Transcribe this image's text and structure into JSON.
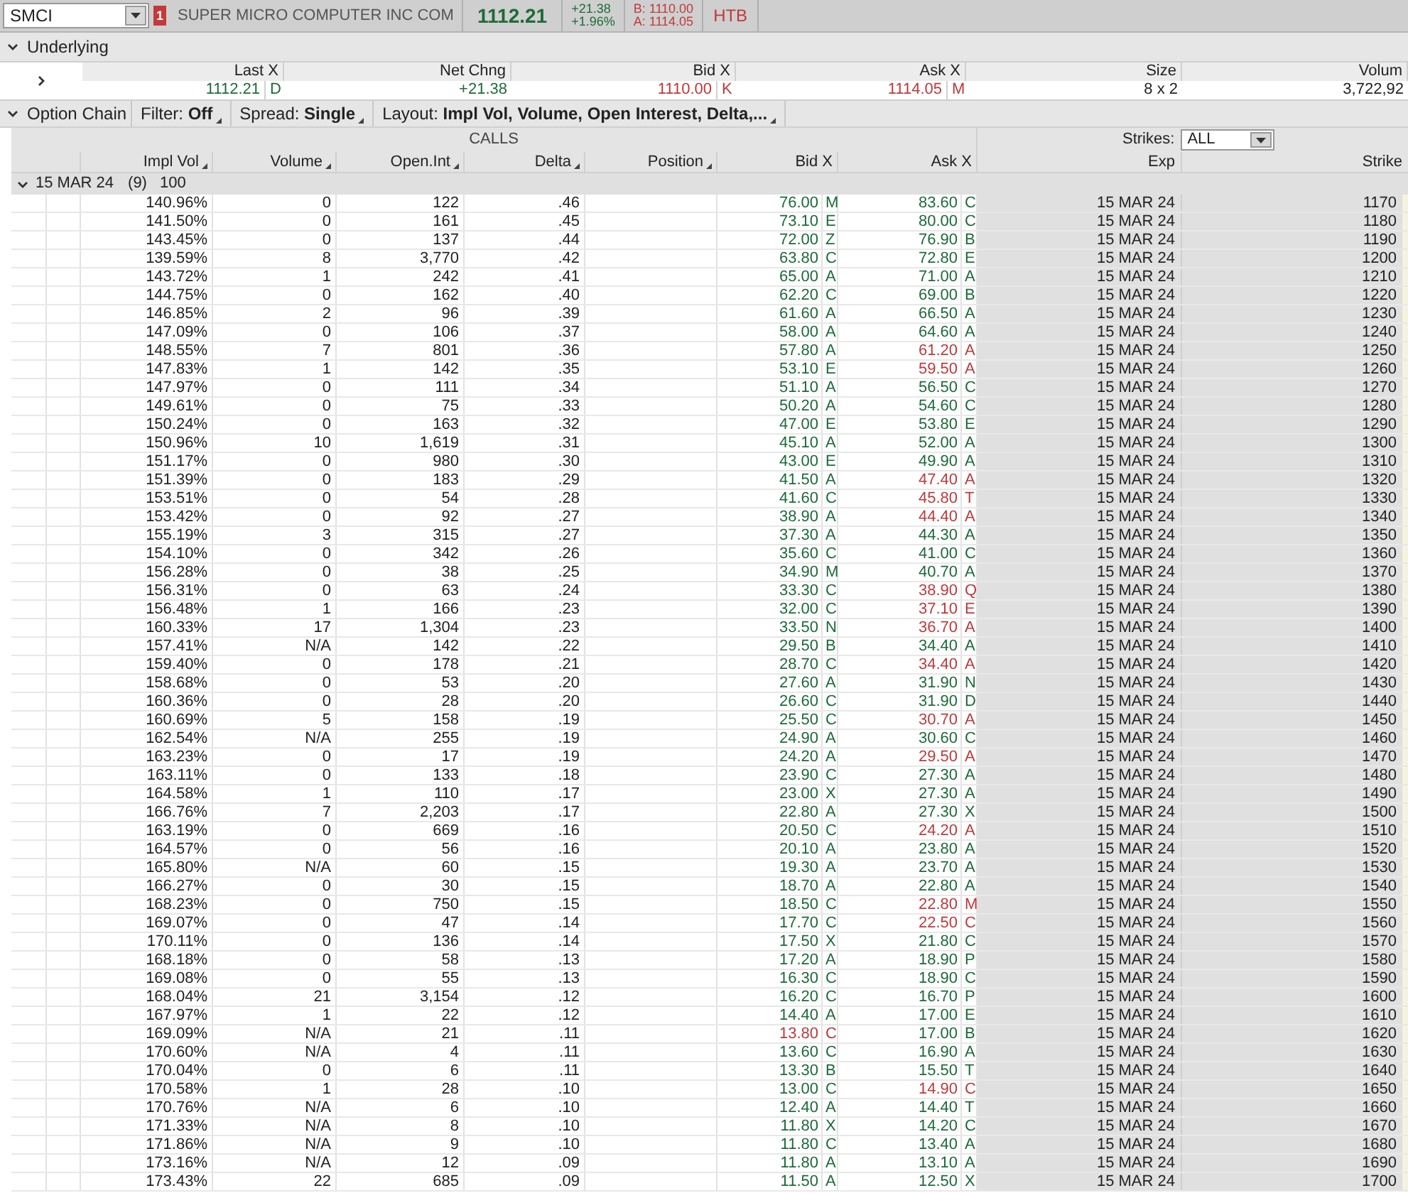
{
  "top_bar": {
    "symbol": "SMCI",
    "alert_badge": "1",
    "company": "SUPER MICRO COMPUTER INC COM",
    "last": "1112.21",
    "change": "+21.38",
    "change_pct": "+1.96%",
    "bid": "B: 1110.00",
    "ask": "A: 1114.05",
    "htb": "HTB"
  },
  "underlying": {
    "title": "Underlying",
    "expanded": true,
    "columns": [
      "Last X",
      "Net Chng",
      "Bid X",
      "Ask X",
      "Size",
      "Volum"
    ],
    "values": [
      {
        "value": "1112.21",
        "exch": "D",
        "color": "#1d6b38"
      },
      {
        "value": "+21.38",
        "color": "#1d6b38"
      },
      {
        "value": "1110.00",
        "exch": "K",
        "color": "#c0393b"
      },
      {
        "value": "1114.05",
        "exch": "M",
        "color": "#c0393b"
      },
      {
        "value": "8 x 2",
        "color": "#222222"
      },
      {
        "value": "3,722,92",
        "color": "#222222"
      }
    ]
  },
  "option_chain": {
    "title": "Option Chain",
    "expanded": true,
    "filter_label": "Filter:",
    "filter": "Off",
    "spread_label": "Spread:",
    "spread": "Single",
    "layout_label": "Layout:",
    "layout": "Impl Vol, Volume, Open Interest, Delta,..."
  },
  "calls_title": "CALLS",
  "strikes_label": "Strikes:",
  "strikes": "ALL",
  "columns": [
    "Impl Vol",
    "Volume",
    "Open.Int",
    "Delta",
    "Position",
    "Bid X",
    "Ask X",
    "Exp",
    "Strike"
  ],
  "series": {
    "label": "15 MAR 24",
    "count": "(9)",
    "multiplier": "100",
    "expanded": true
  },
  "rows": [
    {
      "impl_vol": "140.96%",
      "volume": "0",
      "open_int": "122",
      "delta": ".46",
      "bid": "76.00",
      "bid_exch": "M",
      "bid_down": false,
      "ask": "83.60",
      "ask_exch": "C",
      "ask_down": false,
      "exp": "15 MAR 24",
      "strike": "1170"
    },
    {
      "impl_vol": "141.50%",
      "volume": "0",
      "open_int": "161",
      "delta": ".45",
      "bid": "73.10",
      "bid_exch": "E",
      "bid_down": false,
      "ask": "80.00",
      "ask_exch": "C",
      "ask_down": false,
      "exp": "15 MAR 24",
      "strike": "1180"
    },
    {
      "impl_vol": "143.45%",
      "volume": "0",
      "open_int": "137",
      "delta": ".44",
      "bid": "72.00",
      "bid_exch": "Z",
      "bid_down": false,
      "ask": "76.90",
      "ask_exch": "B",
      "ask_down": false,
      "exp": "15 MAR 24",
      "strike": "1190"
    },
    {
      "impl_vol": "139.59%",
      "volume": "8",
      "open_int": "3,770",
      "delta": ".42",
      "bid": "63.80",
      "bid_exch": "C",
      "bid_down": false,
      "ask": "72.80",
      "ask_exch": "E",
      "ask_down": false,
      "exp": "15 MAR 24",
      "strike": "1200"
    },
    {
      "impl_vol": "143.72%",
      "volume": "1",
      "open_int": "242",
      "delta": ".41",
      "bid": "65.00",
      "bid_exch": "A",
      "bid_down": false,
      "ask": "71.00",
      "ask_exch": "A",
      "ask_down": false,
      "exp": "15 MAR 24",
      "strike": "1210"
    },
    {
      "impl_vol": "144.75%",
      "volume": "0",
      "open_int": "162",
      "delta": ".40",
      "bid": "62.20",
      "bid_exch": "C",
      "bid_down": false,
      "ask": "69.00",
      "ask_exch": "B",
      "ask_down": false,
      "exp": "15 MAR 24",
      "strike": "1220"
    },
    {
      "impl_vol": "146.85%",
      "volume": "2",
      "open_int": "96",
      "delta": ".39",
      "bid": "61.60",
      "bid_exch": "A",
      "bid_down": false,
      "ask": "66.50",
      "ask_exch": "A",
      "ask_down": false,
      "exp": "15 MAR 24",
      "strike": "1230"
    },
    {
      "impl_vol": "147.09%",
      "volume": "0",
      "open_int": "106",
      "delta": ".37",
      "bid": "58.00",
      "bid_exch": "A",
      "bid_down": false,
      "ask": "64.60",
      "ask_exch": "A",
      "ask_down": false,
      "exp": "15 MAR 24",
      "strike": "1240"
    },
    {
      "impl_vol": "148.55%",
      "volume": "7",
      "open_int": "801",
      "delta": ".36",
      "bid": "57.80",
      "bid_exch": "A",
      "bid_down": false,
      "ask": "61.20",
      "ask_exch": "A",
      "ask_down": true,
      "exp": "15 MAR 24",
      "strike": "1250"
    },
    {
      "impl_vol": "147.83%",
      "volume": "1",
      "open_int": "142",
      "delta": ".35",
      "bid": "53.10",
      "bid_exch": "E",
      "bid_down": false,
      "ask": "59.50",
      "ask_exch": "A",
      "ask_down": true,
      "exp": "15 MAR 24",
      "strike": "1260"
    },
    {
      "impl_vol": "147.97%",
      "volume": "0",
      "open_int": "111",
      "delta": ".34",
      "bid": "51.10",
      "bid_exch": "A",
      "bid_down": false,
      "ask": "56.50",
      "ask_exch": "C",
      "ask_down": false,
      "exp": "15 MAR 24",
      "strike": "1270"
    },
    {
      "impl_vol": "149.61%",
      "volume": "0",
      "open_int": "75",
      "delta": ".33",
      "bid": "50.20",
      "bid_exch": "A",
      "bid_down": false,
      "ask": "54.60",
      "ask_exch": "C",
      "ask_down": false,
      "exp": "15 MAR 24",
      "strike": "1280"
    },
    {
      "impl_vol": "150.24%",
      "volume": "0",
      "open_int": "163",
      "delta": ".32",
      "bid": "47.00",
      "bid_exch": "E",
      "bid_down": false,
      "ask": "53.80",
      "ask_exch": "E",
      "ask_down": false,
      "exp": "15 MAR 24",
      "strike": "1290"
    },
    {
      "impl_vol": "150.96%",
      "volume": "10",
      "open_int": "1,619",
      "delta": ".31",
      "bid": "45.10",
      "bid_exch": "A",
      "bid_down": false,
      "ask": "52.00",
      "ask_exch": "A",
      "ask_down": false,
      "exp": "15 MAR 24",
      "strike": "1300"
    },
    {
      "impl_vol": "151.17%",
      "volume": "0",
      "open_int": "980",
      "delta": ".30",
      "bid": "43.00",
      "bid_exch": "E",
      "bid_down": false,
      "ask": "49.90",
      "ask_exch": "A",
      "ask_down": false,
      "exp": "15 MAR 24",
      "strike": "1310"
    },
    {
      "impl_vol": "151.39%",
      "volume": "0",
      "open_int": "183",
      "delta": ".29",
      "bid": "41.50",
      "bid_exch": "A",
      "bid_down": false,
      "ask": "47.40",
      "ask_exch": "A",
      "ask_down": true,
      "exp": "15 MAR 24",
      "strike": "1320"
    },
    {
      "impl_vol": "153.51%",
      "volume": "0",
      "open_int": "54",
      "delta": ".28",
      "bid": "41.60",
      "bid_exch": "C",
      "bid_down": false,
      "ask": "45.80",
      "ask_exch": "T",
      "ask_down": true,
      "exp": "15 MAR 24",
      "strike": "1330"
    },
    {
      "impl_vol": "153.42%",
      "volume": "0",
      "open_int": "92",
      "delta": ".27",
      "bid": "38.90",
      "bid_exch": "A",
      "bid_down": false,
      "ask": "44.40",
      "ask_exch": "A",
      "ask_down": true,
      "exp": "15 MAR 24",
      "strike": "1340"
    },
    {
      "impl_vol": "155.19%",
      "volume": "3",
      "open_int": "315",
      "delta": ".27",
      "bid": "37.30",
      "bid_exch": "A",
      "bid_down": false,
      "ask": "44.30",
      "ask_exch": "A",
      "ask_down": false,
      "exp": "15 MAR 24",
      "strike": "1350"
    },
    {
      "impl_vol": "154.10%",
      "volume": "0",
      "open_int": "342",
      "delta": ".26",
      "bid": "35.60",
      "bid_exch": "C",
      "bid_down": false,
      "ask": "41.00",
      "ask_exch": "C",
      "ask_down": false,
      "exp": "15 MAR 24",
      "strike": "1360"
    },
    {
      "impl_vol": "156.28%",
      "volume": "0",
      "open_int": "38",
      "delta": ".25",
      "bid": "34.90",
      "bid_exch": "M",
      "bid_down": false,
      "ask": "40.70",
      "ask_exch": "A",
      "ask_down": false,
      "exp": "15 MAR 24",
      "strike": "1370"
    },
    {
      "impl_vol": "156.31%",
      "volume": "0",
      "open_int": "63",
      "delta": ".24",
      "bid": "33.30",
      "bid_exch": "C",
      "bid_down": false,
      "ask": "38.90",
      "ask_exch": "Q",
      "ask_down": true,
      "exp": "15 MAR 24",
      "strike": "1380"
    },
    {
      "impl_vol": "156.48%",
      "volume": "1",
      "open_int": "166",
      "delta": ".23",
      "bid": "32.00",
      "bid_exch": "C",
      "bid_down": false,
      "ask": "37.10",
      "ask_exch": "E",
      "ask_down": true,
      "exp": "15 MAR 24",
      "strike": "1390"
    },
    {
      "impl_vol": "160.33%",
      "volume": "17",
      "open_int": "1,304",
      "delta": ".23",
      "bid": "33.50",
      "bid_exch": "N",
      "bid_down": false,
      "ask": "36.70",
      "ask_exch": "A",
      "ask_down": true,
      "exp": "15 MAR 24",
      "strike": "1400"
    },
    {
      "impl_vol": "157.41%",
      "volume": "N/A",
      "open_int": "142",
      "delta": ".22",
      "bid": "29.50",
      "bid_exch": "B",
      "bid_down": false,
      "ask": "34.40",
      "ask_exch": "A",
      "ask_down": false,
      "exp": "15 MAR 24",
      "strike": "1410"
    },
    {
      "impl_vol": "159.40%",
      "volume": "0",
      "open_int": "178",
      "delta": ".21",
      "bid": "28.70",
      "bid_exch": "C",
      "bid_down": false,
      "ask": "34.40",
      "ask_exch": "A",
      "ask_down": true,
      "exp": "15 MAR 24",
      "strike": "1420"
    },
    {
      "impl_vol": "158.68%",
      "volume": "0",
      "open_int": "53",
      "delta": ".20",
      "bid": "27.60",
      "bid_exch": "A",
      "bid_down": false,
      "ask": "31.90",
      "ask_exch": "N",
      "ask_down": false,
      "exp": "15 MAR 24",
      "strike": "1430"
    },
    {
      "impl_vol": "160.36%",
      "volume": "0",
      "open_int": "28",
      "delta": ".20",
      "bid": "26.60",
      "bid_exch": "C",
      "bid_down": false,
      "ask": "31.90",
      "ask_exch": "D",
      "ask_down": false,
      "exp": "15 MAR 24",
      "strike": "1440"
    },
    {
      "impl_vol": "160.69%",
      "volume": "5",
      "open_int": "158",
      "delta": ".19",
      "bid": "25.50",
      "bid_exch": "C",
      "bid_down": false,
      "ask": "30.70",
      "ask_exch": "A",
      "ask_down": true,
      "exp": "15 MAR 24",
      "strike": "1450"
    },
    {
      "impl_vol": "162.54%",
      "volume": "N/A",
      "open_int": "255",
      "delta": ".19",
      "bid": "24.90",
      "bid_exch": "A",
      "bid_down": false,
      "ask": "30.60",
      "ask_exch": "C",
      "ask_down": false,
      "exp": "15 MAR 24",
      "strike": "1460"
    },
    {
      "impl_vol": "163.23%",
      "volume": "0",
      "open_int": "17",
      "delta": ".19",
      "bid": "24.20",
      "bid_exch": "A",
      "bid_down": false,
      "ask": "29.50",
      "ask_exch": "A",
      "ask_down": true,
      "exp": "15 MAR 24",
      "strike": "1470"
    },
    {
      "impl_vol": "163.11%",
      "volume": "0",
      "open_int": "133",
      "delta": ".18",
      "bid": "23.90",
      "bid_exch": "C",
      "bid_down": false,
      "ask": "27.30",
      "ask_exch": "A",
      "ask_down": false,
      "exp": "15 MAR 24",
      "strike": "1480"
    },
    {
      "impl_vol": "164.58%",
      "volume": "1",
      "open_int": "110",
      "delta": ".17",
      "bid": "23.00",
      "bid_exch": "X",
      "bid_down": false,
      "ask": "27.30",
      "ask_exch": "A",
      "ask_down": false,
      "exp": "15 MAR 24",
      "strike": "1490"
    },
    {
      "impl_vol": "166.76%",
      "volume": "7",
      "open_int": "2,203",
      "delta": ".17",
      "bid": "22.80",
      "bid_exch": "A",
      "bid_down": false,
      "ask": "27.30",
      "ask_exch": "X",
      "ask_down": false,
      "exp": "15 MAR 24",
      "strike": "1500"
    },
    {
      "impl_vol": "163.19%",
      "volume": "0",
      "open_int": "669",
      "delta": ".16",
      "bid": "20.50",
      "bid_exch": "C",
      "bid_down": false,
      "ask": "24.20",
      "ask_exch": "A",
      "ask_down": true,
      "exp": "15 MAR 24",
      "strike": "1510"
    },
    {
      "impl_vol": "164.57%",
      "volume": "0",
      "open_int": "56",
      "delta": ".16",
      "bid": "20.10",
      "bid_exch": "A",
      "bid_down": false,
      "ask": "23.80",
      "ask_exch": "A",
      "ask_down": false,
      "exp": "15 MAR 24",
      "strike": "1520"
    },
    {
      "impl_vol": "165.80%",
      "volume": "N/A",
      "open_int": "60",
      "delta": ".15",
      "bid": "19.30",
      "bid_exch": "A",
      "bid_down": false,
      "ask": "23.70",
      "ask_exch": "A",
      "ask_down": false,
      "exp": "15 MAR 24",
      "strike": "1530"
    },
    {
      "impl_vol": "166.27%",
      "volume": "0",
      "open_int": "30",
      "delta": ".15",
      "bid": "18.70",
      "bid_exch": "A",
      "bid_down": false,
      "ask": "22.80",
      "ask_exch": "A",
      "ask_down": false,
      "exp": "15 MAR 24",
      "strike": "1540"
    },
    {
      "impl_vol": "168.23%",
      "volume": "0",
      "open_int": "750",
      "delta": ".15",
      "bid": "18.50",
      "bid_exch": "C",
      "bid_down": false,
      "ask": "22.80",
      "ask_exch": "M",
      "ask_down": true,
      "exp": "15 MAR 24",
      "strike": "1550"
    },
    {
      "impl_vol": "169.07%",
      "volume": "0",
      "open_int": "47",
      "delta": ".14",
      "bid": "17.70",
      "bid_exch": "C",
      "bid_down": false,
      "ask": "22.50",
      "ask_exch": "C",
      "ask_down": true,
      "exp": "15 MAR 24",
      "strike": "1560"
    },
    {
      "impl_vol": "170.11%",
      "volume": "0",
      "open_int": "136",
      "delta": ".14",
      "bid": "17.50",
      "bid_exch": "X",
      "bid_down": false,
      "ask": "21.80",
      "ask_exch": "C",
      "ask_down": false,
      "exp": "15 MAR 24",
      "strike": "1570"
    },
    {
      "impl_vol": "168.18%",
      "volume": "0",
      "open_int": "58",
      "delta": ".13",
      "bid": "17.20",
      "bid_exch": "A",
      "bid_down": false,
      "ask": "18.90",
      "ask_exch": "P",
      "ask_down": false,
      "exp": "15 MAR 24",
      "strike": "1580"
    },
    {
      "impl_vol": "169.08%",
      "volume": "0",
      "open_int": "55",
      "delta": ".13",
      "bid": "16.30",
      "bid_exch": "C",
      "bid_down": false,
      "ask": "18.90",
      "ask_exch": "C",
      "ask_down": false,
      "exp": "15 MAR 24",
      "strike": "1590"
    },
    {
      "impl_vol": "168.04%",
      "volume": "21",
      "open_int": "3,154",
      "delta": ".12",
      "bid": "16.20",
      "bid_exch": "C",
      "bid_down": false,
      "ask": "16.70",
      "ask_exch": "P",
      "ask_down": false,
      "exp": "15 MAR 24",
      "strike": "1600"
    },
    {
      "impl_vol": "167.97%",
      "volume": "1",
      "open_int": "22",
      "delta": ".12",
      "bid": "14.40",
      "bid_exch": "A",
      "bid_down": false,
      "ask": "17.00",
      "ask_exch": "E",
      "ask_down": false,
      "exp": "15 MAR 24",
      "strike": "1610"
    },
    {
      "impl_vol": "169.09%",
      "volume": "N/A",
      "open_int": "21",
      "delta": ".11",
      "bid": "13.80",
      "bid_exch": "C",
      "bid_down": true,
      "ask": "17.00",
      "ask_exch": "B",
      "ask_down": false,
      "exp": "15 MAR 24",
      "strike": "1620"
    },
    {
      "impl_vol": "170.60%",
      "volume": "N/A",
      "open_int": "4",
      "delta": ".11",
      "bid": "13.60",
      "bid_exch": "C",
      "bid_down": false,
      "ask": "16.90",
      "ask_exch": "A",
      "ask_down": false,
      "exp": "15 MAR 24",
      "strike": "1630"
    },
    {
      "impl_vol": "170.04%",
      "volume": "0",
      "open_int": "6",
      "delta": ".11",
      "bid": "13.30",
      "bid_exch": "B",
      "bid_down": false,
      "ask": "15.50",
      "ask_exch": "T",
      "ask_down": false,
      "exp": "15 MAR 24",
      "strike": "1640"
    },
    {
      "impl_vol": "170.58%",
      "volume": "1",
      "open_int": "28",
      "delta": ".10",
      "bid": "13.00",
      "bid_exch": "C",
      "bid_down": false,
      "ask": "14.90",
      "ask_exch": "C",
      "ask_down": true,
      "exp": "15 MAR 24",
      "strike": "1650"
    },
    {
      "impl_vol": "170.76%",
      "volume": "N/A",
      "open_int": "6",
      "delta": ".10",
      "bid": "12.40",
      "bid_exch": "A",
      "bid_down": false,
      "ask": "14.40",
      "ask_exch": "T",
      "ask_down": false,
      "exp": "15 MAR 24",
      "strike": "1660"
    },
    {
      "impl_vol": "171.33%",
      "volume": "N/A",
      "open_int": "8",
      "delta": ".10",
      "bid": "11.80",
      "bid_exch": "X",
      "bid_down": false,
      "ask": "14.20",
      "ask_exch": "C",
      "ask_down": false,
      "exp": "15 MAR 24",
      "strike": "1670"
    },
    {
      "impl_vol": "171.86%",
      "volume": "N/A",
      "open_int": "9",
      "delta": ".10",
      "bid": "11.80",
      "bid_exch": "C",
      "bid_down": false,
      "ask": "13.40",
      "ask_exch": "A",
      "ask_down": false,
      "exp": "15 MAR 24",
      "strike": "1680"
    },
    {
      "impl_vol": "173.16%",
      "volume": "N/A",
      "open_int": "12",
      "delta": ".09",
      "bid": "11.80",
      "bid_exch": "A",
      "bid_down": false,
      "ask": "13.10",
      "ask_exch": "A",
      "ask_down": false,
      "exp": "15 MAR 24",
      "strike": "1690"
    },
    {
      "impl_vol": "173.43%",
      "volume": "22",
      "open_int": "685",
      "delta": ".09",
      "bid": "11.50",
      "bid_exch": "A",
      "bid_down": false,
      "ask": "12.50",
      "ask_exch": "X",
      "ask_down": false,
      "exp": "15 MAR 24",
      "strike": "1700"
    }
  ]
}
